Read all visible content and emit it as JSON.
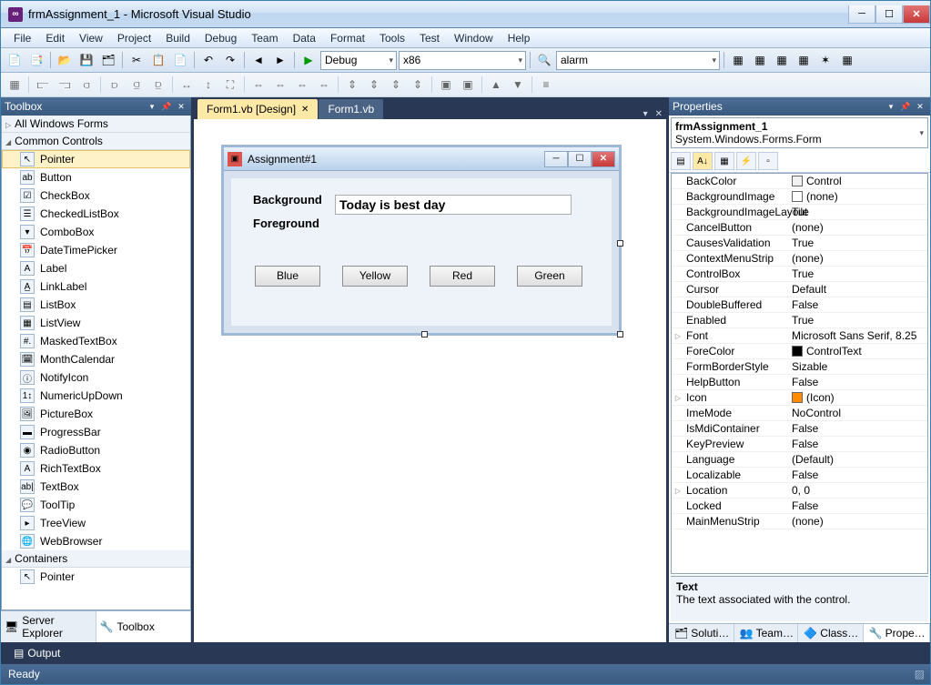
{
  "window": {
    "title": "frmAssignment_1 - Microsoft Visual Studio"
  },
  "menu": [
    "File",
    "Edit",
    "View",
    "Project",
    "Build",
    "Debug",
    "Team",
    "Data",
    "Format",
    "Tools",
    "Test",
    "Window",
    "Help"
  ],
  "toolbar1": {
    "config": "Debug",
    "platform": "x86",
    "find": "alarm"
  },
  "tabs": [
    {
      "label": "Form1.vb [Design]",
      "active": true
    },
    {
      "label": "Form1.vb",
      "active": false
    }
  ],
  "toolbox": {
    "title": "Toolbox",
    "groups": [
      {
        "label": "All Windows Forms",
        "collapsed": true
      },
      {
        "label": "Common Controls",
        "collapsed": false
      }
    ],
    "items": [
      "Pointer",
      "Button",
      "CheckBox",
      "CheckedListBox",
      "ComboBox",
      "DateTimePicker",
      "Label",
      "LinkLabel",
      "ListBox",
      "ListView",
      "MaskedTextBox",
      "MonthCalendar",
      "NotifyIcon",
      "NumericUpDown",
      "PictureBox",
      "ProgressBar",
      "RadioButton",
      "RichTextBox",
      "TextBox",
      "ToolTip",
      "TreeView",
      "WebBrowser"
    ],
    "group3": "Containers",
    "group3item": "Pointer",
    "bottom_tabs": [
      "Server Explorer",
      "Toolbox"
    ]
  },
  "designer": {
    "form_title": "Assignment#1",
    "labels": {
      "bg": "Background",
      "fg": "Foreground"
    },
    "textbox": "Today is best day",
    "buttons": [
      "Blue",
      "Yellow",
      "Red",
      "Green"
    ]
  },
  "properties": {
    "title": "Properties",
    "object": "frmAssignment_1  System.Windows.Forms.Form",
    "rows": [
      {
        "n": "BackColor",
        "v": "Control",
        "sw": "#f0f0f0"
      },
      {
        "n": "BackgroundImage",
        "v": "(none)",
        "sw": "#fff"
      },
      {
        "n": "BackgroundImageLayout",
        "v": "Tile"
      },
      {
        "n": "CancelButton",
        "v": "(none)"
      },
      {
        "n": "CausesValidation",
        "v": "True"
      },
      {
        "n": "ContextMenuStrip",
        "v": "(none)"
      },
      {
        "n": "ControlBox",
        "v": "True"
      },
      {
        "n": "Cursor",
        "v": "Default"
      },
      {
        "n": "DoubleBuffered",
        "v": "False"
      },
      {
        "n": "Enabled",
        "v": "True"
      },
      {
        "n": "Font",
        "v": "Microsoft Sans Serif, 8.25",
        "exp": true
      },
      {
        "n": "ForeColor",
        "v": "ControlText",
        "sw": "#000"
      },
      {
        "n": "FormBorderStyle",
        "v": "Sizable"
      },
      {
        "n": "HelpButton",
        "v": "False"
      },
      {
        "n": "Icon",
        "v": "(Icon)",
        "sw": "#ff8c00",
        "exp": true
      },
      {
        "n": "ImeMode",
        "v": "NoControl"
      },
      {
        "n": "IsMdiContainer",
        "v": "False"
      },
      {
        "n": "KeyPreview",
        "v": "False"
      },
      {
        "n": "Language",
        "v": "(Default)"
      },
      {
        "n": "Localizable",
        "v": "False"
      },
      {
        "n": "Location",
        "v": "0, 0",
        "exp": true
      },
      {
        "n": "Locked",
        "v": "False"
      },
      {
        "n": "MainMenuStrip",
        "v": "(none)"
      }
    ],
    "desc_title": "Text",
    "desc_body": "The text associated with the control.",
    "bottom_tabs": [
      "Soluti…",
      "Team…",
      "Class…",
      "Prope…"
    ]
  },
  "output_tab": "Output",
  "status": "Ready"
}
